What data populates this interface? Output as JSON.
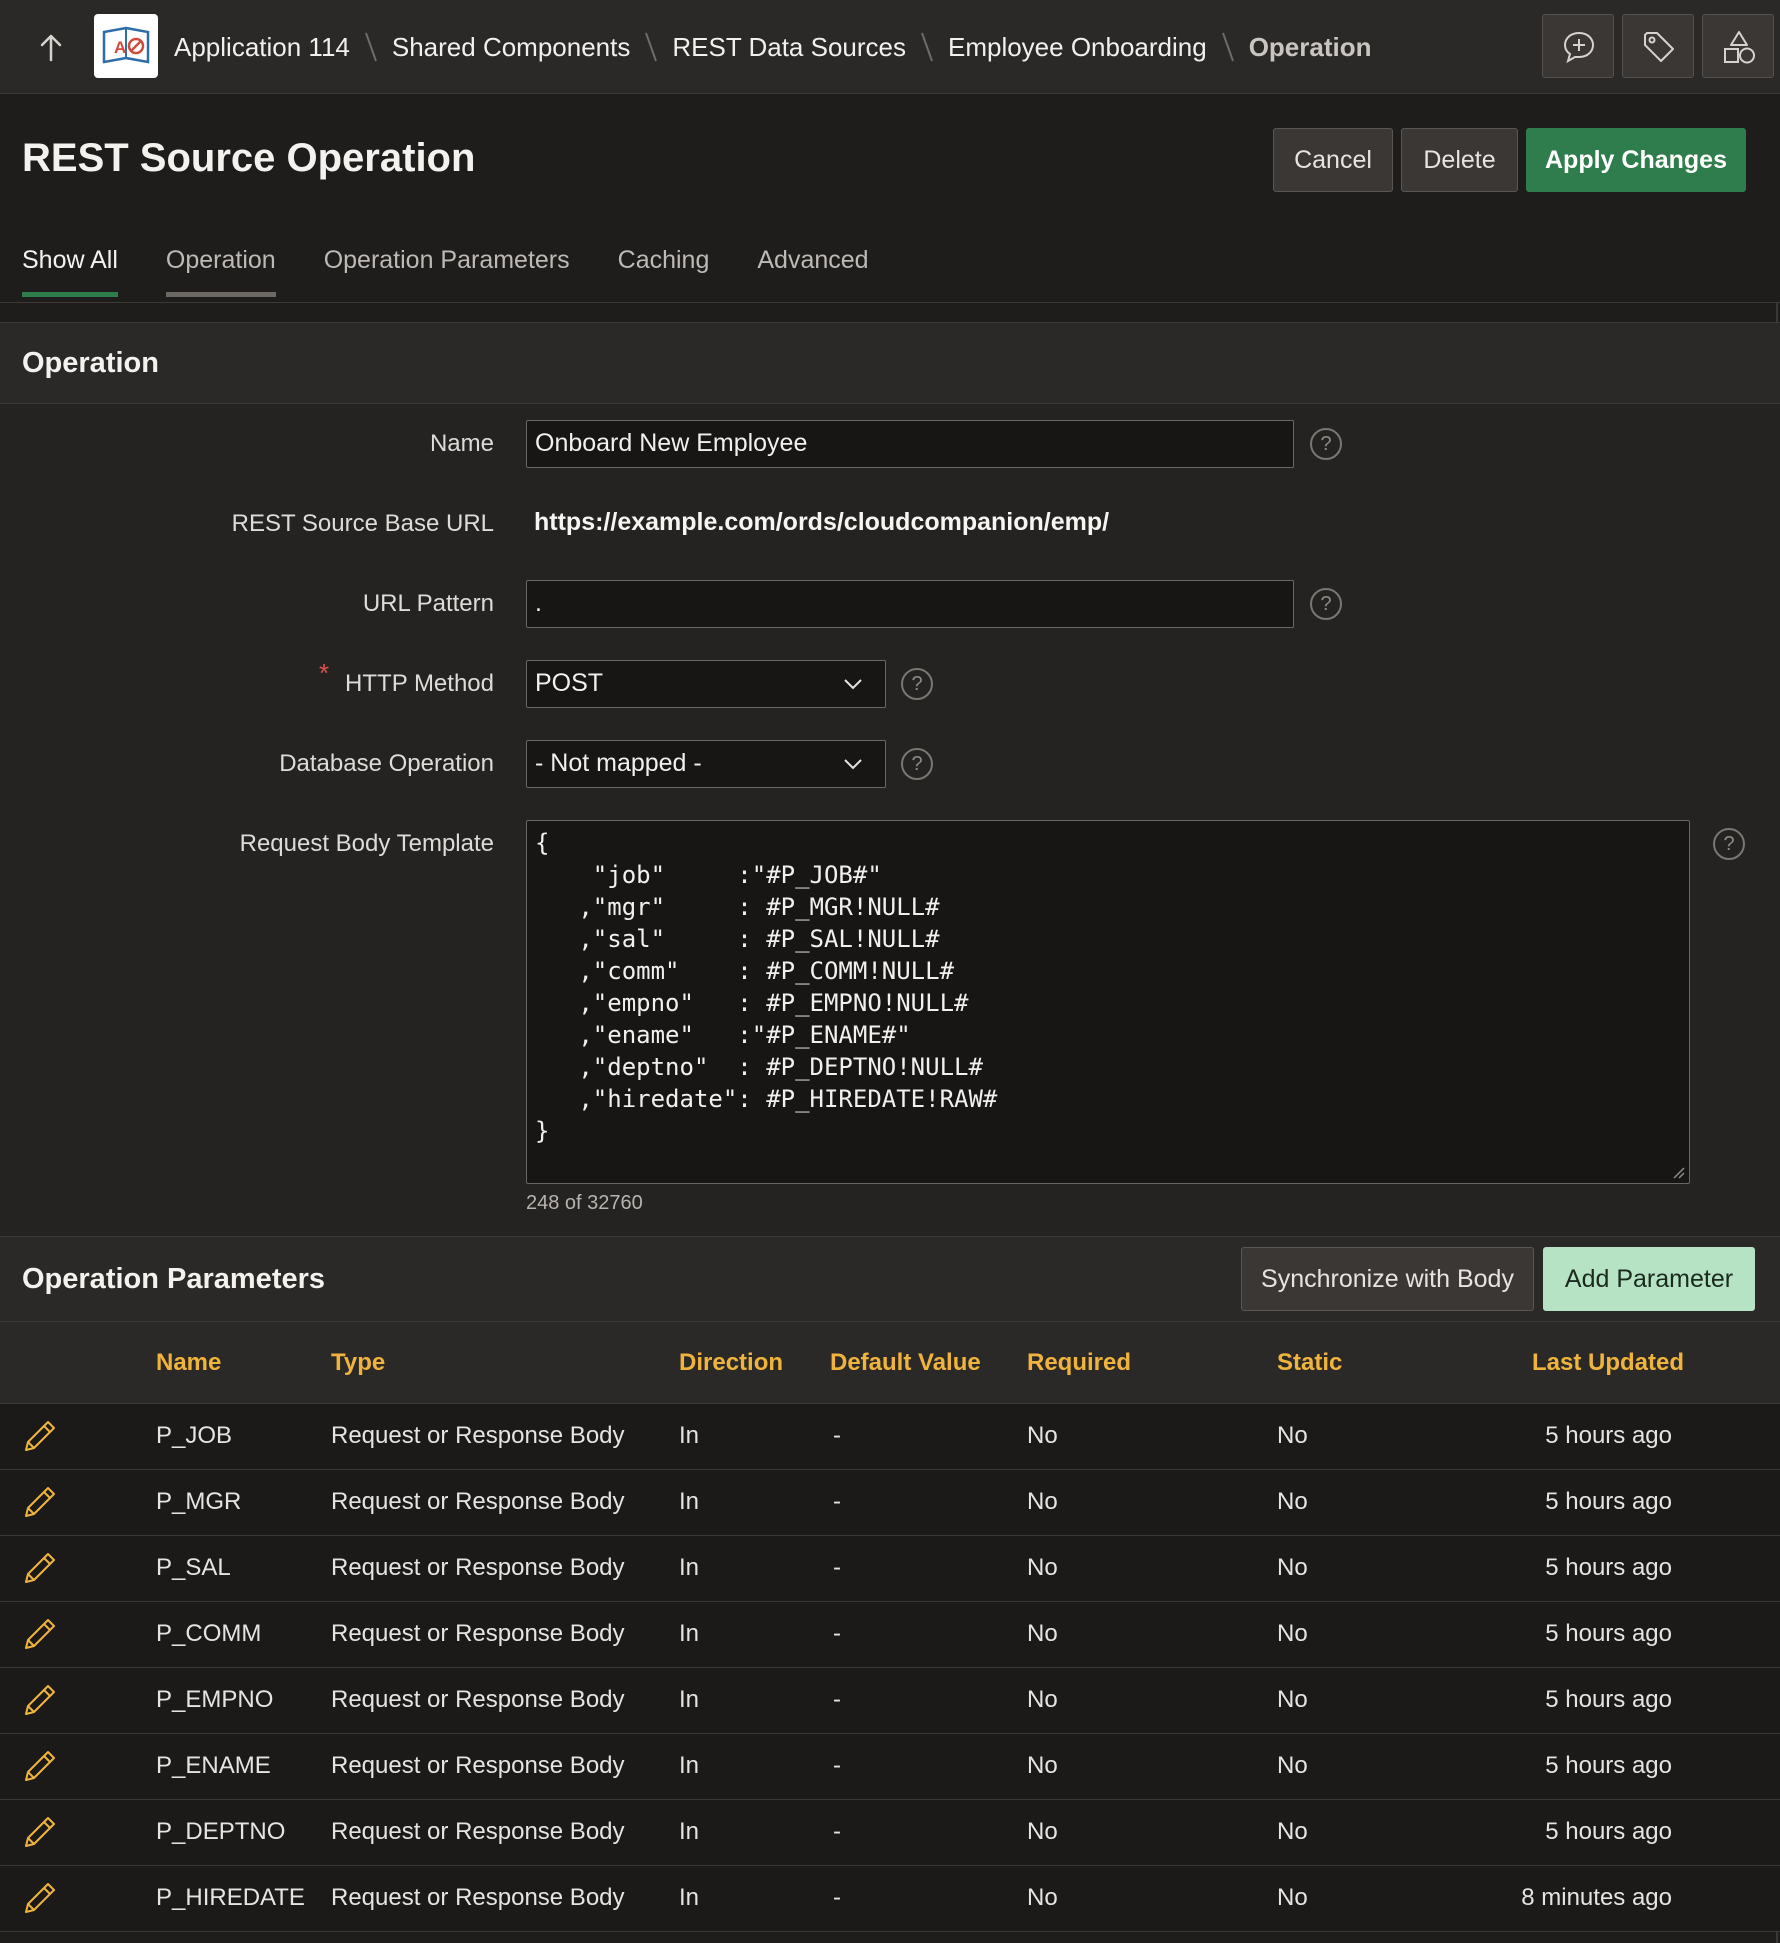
{
  "breadcrumb": {
    "items": [
      "Application 114",
      "Shared Components",
      "REST Data Sources",
      "Employee Onboarding"
    ],
    "current": "Operation"
  },
  "icons": {
    "up": "arrow-up-icon",
    "app": "app-builder-icon",
    "toolbar": [
      "add-comment-icon",
      "tag-icon",
      "shapes-icon"
    ]
  },
  "page": {
    "title": "REST Source Operation",
    "buttons": {
      "cancel": "Cancel",
      "delete": "Delete",
      "apply": "Apply Changes"
    }
  },
  "tabs": [
    "Show All",
    "Operation",
    "Operation Parameters",
    "Caching",
    "Advanced"
  ],
  "operation": {
    "region_title": "Operation",
    "fields": {
      "name_label": "Name",
      "name_value": "Onboard New Employee",
      "base_url_label": "REST Source Base URL",
      "base_url_value": "https://example.com/ords/cloudcompanion/emp/",
      "url_pattern_label": "URL Pattern",
      "url_pattern_value": ".",
      "http_method_label": "HTTP Method",
      "http_method_value": "POST",
      "db_op_label": "Database Operation",
      "db_op_value": "- Not mapped -",
      "body_label": "Request Body Template",
      "body_lines": [
        "{",
        "    \"job\"     :\"#P_JOB#\"",
        "   ,\"mgr\"     : #P_MGR!NULL#",
        "   ,\"sal\"     : #P_SAL!NULL#",
        "   ,\"comm\"    : #P_COMM!NULL#",
        "   ,\"empno\"   : #P_EMPNO!NULL#",
        "   ,\"ename\"   :\"#P_ENAME#\"",
        "   ,\"deptno\"  : #P_DEPTNO!NULL#",
        "   ,\"hiredate\": #P_HIREDATE!RAW#",
        "}"
      ],
      "counter": "248 of 32760",
      "help": "?"
    }
  },
  "params": {
    "region_title": "Operation Parameters",
    "buttons": {
      "sync": "Synchronize with Body",
      "add": "Add Parameter"
    },
    "columns": [
      "Name",
      "Type",
      "Direction",
      "Default Value",
      "Required",
      "Static",
      "Last Updated"
    ],
    "rows": [
      [
        "P_JOB",
        "Request or Response Body",
        "In",
        "-",
        "No",
        "No",
        "5 hours ago"
      ],
      [
        "P_MGR",
        "Request or Response Body",
        "In",
        "-",
        "No",
        "No",
        "5 hours ago"
      ],
      [
        "P_SAL",
        "Request or Response Body",
        "In",
        "-",
        "No",
        "No",
        "5 hours ago"
      ],
      [
        "P_COMM",
        "Request or Response Body",
        "In",
        "-",
        "No",
        "No",
        "5 hours ago"
      ],
      [
        "P_EMPNO",
        "Request or Response Body",
        "In",
        "-",
        "No",
        "No",
        "5 hours ago"
      ],
      [
        "P_ENAME",
        "Request or Response Body",
        "In",
        "-",
        "No",
        "No",
        "5 hours ago"
      ],
      [
        "P_DEPTNO",
        "Request or Response Body",
        "In",
        "-",
        "No",
        "No",
        "5 hours ago"
      ],
      [
        "P_HIREDATE",
        "Request or Response Body",
        "In",
        "-",
        "No",
        "No",
        "8 minutes ago"
      ]
    ]
  },
  "colors": {
    "accent_green": "#2f7d4d",
    "add_button": "#b6e3c4",
    "column_header": "#f0b43c",
    "required_star": "#d9534f"
  }
}
